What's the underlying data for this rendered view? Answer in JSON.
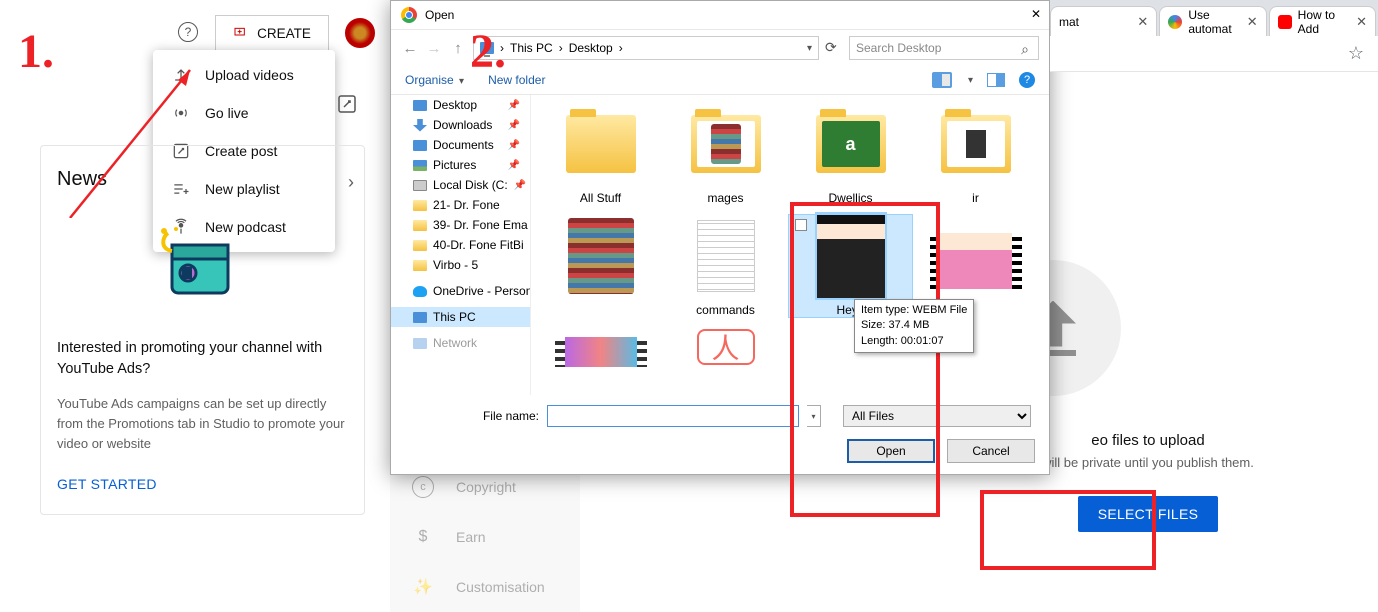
{
  "topbar": {
    "help_tooltip": "?",
    "create_label": "CREATE"
  },
  "create_menu": {
    "items": [
      {
        "label": "Upload videos",
        "icon": "upload-icon"
      },
      {
        "label": "Go live",
        "icon": "antenna-icon"
      },
      {
        "label": "Create post",
        "icon": "pencil-box-icon"
      },
      {
        "label": "New playlist",
        "icon": "playlist-add-icon"
      },
      {
        "label": "New podcast",
        "icon": "podcast-icon"
      }
    ]
  },
  "news_card": {
    "title": "News",
    "heading": "Interested in promoting your channel with YouTube Ads?",
    "body": "YouTube Ads campaigns can be set up directly from the Promotions tab in Studio to promote your video or website",
    "cta": "GET STARTED"
  },
  "left_nav": {
    "items": [
      {
        "label": "Copyright",
        "icon": "copyright-icon"
      },
      {
        "label": "Earn",
        "icon": "dollar-icon"
      },
      {
        "label": "Customisation",
        "icon": "wand-icon"
      }
    ]
  },
  "file_dialog": {
    "title": "Open",
    "breadcrumbs": [
      "This PC",
      "Desktop"
    ],
    "search_placeholder": "Search Desktop",
    "organise_label": "Organise",
    "new_folder_label": "New folder",
    "tree": [
      {
        "label": "Desktop",
        "icon": "desktop",
        "pinned": true
      },
      {
        "label": "Downloads",
        "icon": "dl",
        "pinned": true
      },
      {
        "label": "Documents",
        "icon": "doc",
        "pinned": true
      },
      {
        "label": "Pictures",
        "icon": "pic",
        "pinned": true
      },
      {
        "label": "Local Disk (C:",
        "icon": "disk",
        "pinned": true
      },
      {
        "label": "21- Dr. Fone",
        "icon": "folder"
      },
      {
        "label": "39- Dr. Fone Ema",
        "icon": "folder"
      },
      {
        "label": "40-Dr. Fone FitBi",
        "icon": "folder"
      },
      {
        "label": "Virbo - 5",
        "icon": "folder"
      },
      {
        "label": "OneDrive - Person",
        "icon": "cloud",
        "sep_before": true
      },
      {
        "label": "This PC",
        "icon": "desktop",
        "selected": true,
        "sep_before": true
      },
      {
        "label": "Network",
        "icon": "desktop",
        "sep_before": true
      }
    ],
    "files": [
      {
        "name": "All Stuff",
        "type": "folder"
      },
      {
        "name": "mages",
        "type": "folder-rar"
      },
      {
        "name": "Dwellics",
        "type": "folder-xls"
      },
      {
        "name": "ir",
        "type": "folder-vid"
      },
      {
        "name": "",
        "type": "rar"
      },
      {
        "name": "commands",
        "type": "txt"
      },
      {
        "name": "Hey t",
        "type": "person",
        "selected": true
      },
      {
        "name": "",
        "type": "video2"
      },
      {
        "name": "",
        "type": "video3"
      },
      {
        "name": "",
        "type": "pdf"
      }
    ],
    "tooltip": {
      "line1": "Item type: WEBM File",
      "line2": "Size: 37.4 MB",
      "line3": "Length: 00:01:07"
    },
    "filename_label": "File name:",
    "filename_value": "",
    "filter_value": "All Files",
    "open_btn": "Open",
    "cancel_btn": "Cancel"
  },
  "browser_tabs": [
    {
      "label": "mat",
      "icon_color": "#888"
    },
    {
      "label": "Use automat",
      "icon_color": "#4285f4"
    },
    {
      "label": "How to Add",
      "icon_color": "#ff0000"
    }
  ],
  "upload": {
    "text": "eo files to upload",
    "subtext": "will be private until you publish them.",
    "button": "SELECT FILES"
  },
  "annotations": {
    "label1": "1.",
    "label2": "2."
  }
}
